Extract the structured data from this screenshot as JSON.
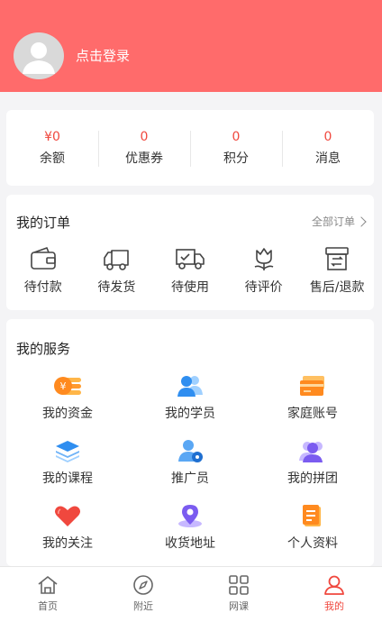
{
  "header": {
    "login_text": "点击登录"
  },
  "stats": [
    {
      "value": "¥0",
      "label": "余额"
    },
    {
      "value": "0",
      "label": "优惠券"
    },
    {
      "value": "0",
      "label": "积分"
    },
    {
      "value": "0",
      "label": "消息"
    }
  ],
  "orders": {
    "title": "我的订单",
    "all_label": "全部订单",
    "items": [
      {
        "label": "待付款",
        "icon": "wallet-icon"
      },
      {
        "label": "待发货",
        "icon": "truck-icon"
      },
      {
        "label": "待使用",
        "icon": "truck-check-icon"
      },
      {
        "label": "待评价",
        "icon": "flower-icon"
      },
      {
        "label": "售后/退款",
        "icon": "archive-box-icon"
      }
    ]
  },
  "services": {
    "title": "我的服务",
    "items": [
      {
        "label": "我的资金",
        "icon": "coins-icon"
      },
      {
        "label": "我的学员",
        "icon": "students-icon"
      },
      {
        "label": "家庭账号",
        "icon": "card-icon"
      },
      {
        "label": "我的课程",
        "icon": "layers-icon"
      },
      {
        "label": "推广员",
        "icon": "promoter-icon"
      },
      {
        "label": "我的拼团",
        "icon": "group-icon"
      },
      {
        "label": "我的关注",
        "icon": "heart-icon"
      },
      {
        "label": "收货地址",
        "icon": "location-icon"
      },
      {
        "label": "个人资料",
        "icon": "profile-doc-icon"
      }
    ]
  },
  "tabbar": {
    "items": [
      {
        "label": "首页",
        "icon": "home-icon"
      },
      {
        "label": "附近",
        "icon": "compass-icon"
      },
      {
        "label": "网课",
        "icon": "grid-icon"
      },
      {
        "label": "我的",
        "icon": "user-icon"
      }
    ],
    "active_index": 3
  },
  "colors": {
    "brand": "#ff6b6b",
    "accent": "#f0483e"
  }
}
